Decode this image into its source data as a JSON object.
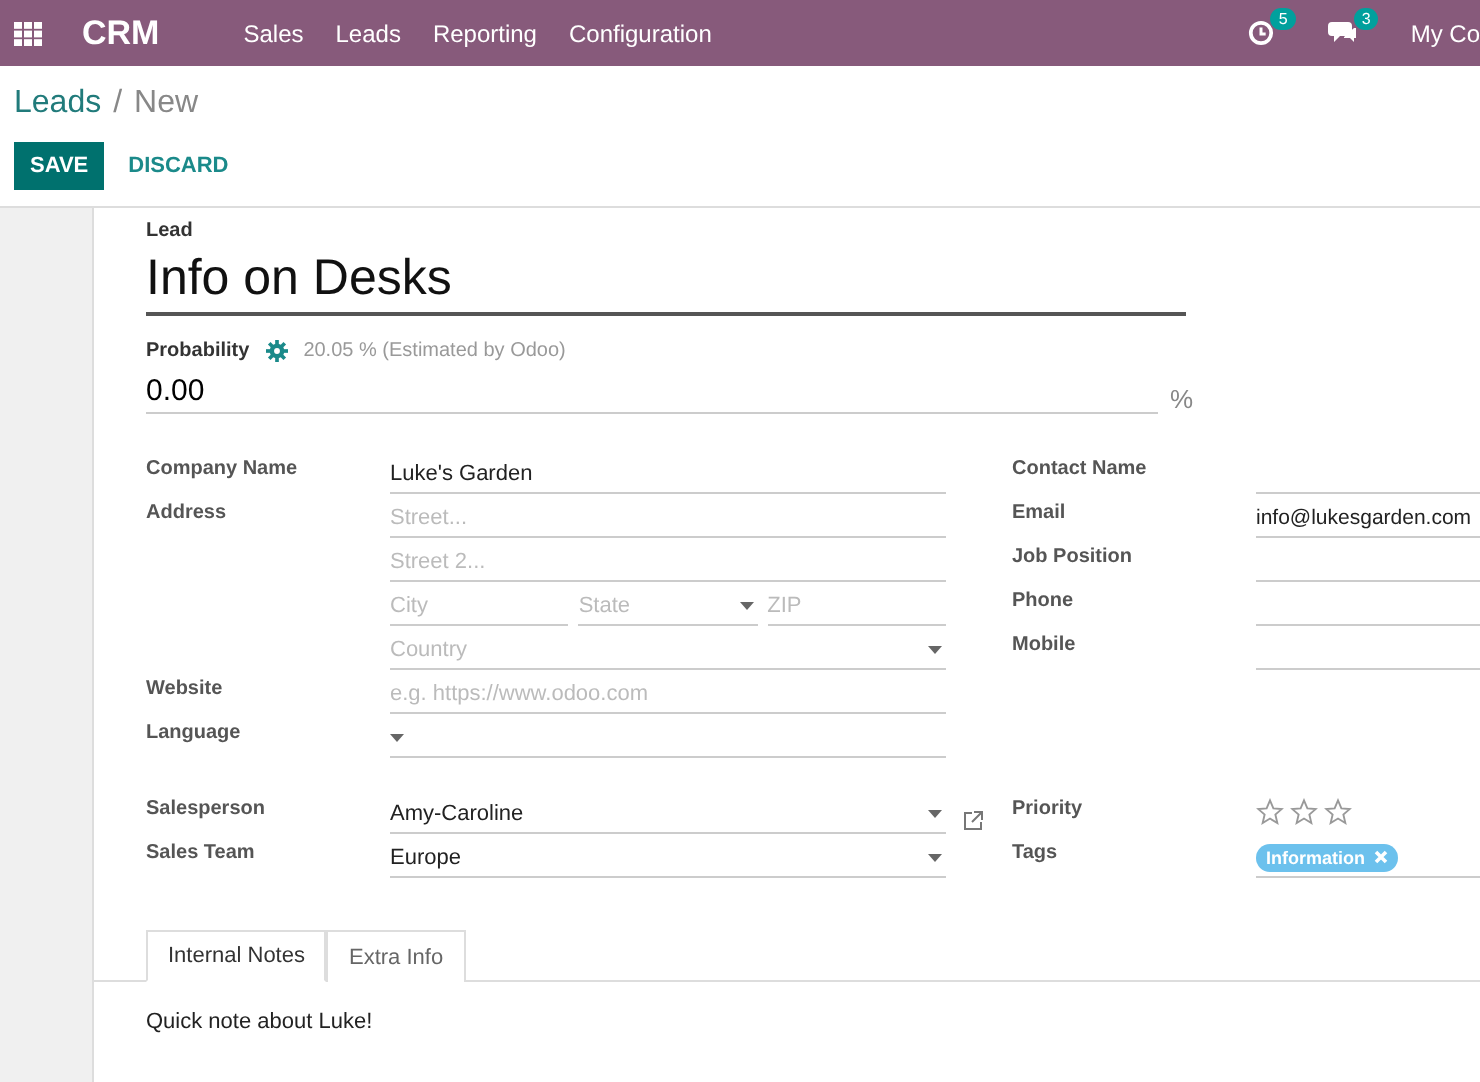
{
  "navbar": {
    "app_name": "CRM",
    "menu": [
      "Sales",
      "Leads",
      "Reporting",
      "Configuration"
    ],
    "activity_count": "5",
    "message_count": "3",
    "company": "My Co"
  },
  "breadcrumb": {
    "parent": "Leads",
    "separator": "/",
    "current": "New"
  },
  "buttons": {
    "primary": "SAVE",
    "secondary": "DISCARD"
  },
  "lead": {
    "label": "Lead",
    "title": "Info on Desks",
    "probability_label": "Probability",
    "probability_estimate": "20.05 % (Estimated by Odoo)",
    "probability": "0.00",
    "percent_sign": "%"
  },
  "left_fields": [
    {
      "label": "Company Name",
      "rows": [
        [
          {
            "kind": "text",
            "value": "Luke's Garden"
          }
        ]
      ],
      "link": false
    },
    {
      "label": "Address",
      "rows": [
        [
          {
            "kind": "text",
            "placeholder": "Street..."
          }
        ],
        [
          {
            "kind": "text",
            "placeholder": "Street 2..."
          }
        ],
        [
          {
            "kind": "text",
            "placeholder": "City"
          },
          {
            "kind": "select",
            "placeholder": "State"
          },
          {
            "kind": "text",
            "placeholder": "ZIP"
          }
        ],
        [
          {
            "kind": "select",
            "placeholder": "Country"
          }
        ]
      ],
      "link": false
    },
    {
      "label": "Website",
      "rows": [
        [
          {
            "kind": "text",
            "placeholder": "e.g. https://www.odoo.com"
          }
        ]
      ],
      "link": false
    },
    {
      "label": "Language",
      "rows": [
        [
          {
            "kind": "select"
          }
        ]
      ],
      "link": false
    },
    {
      "label": "Salesperson",
      "rows": [
        [
          {
            "kind": "select",
            "value": "Amy-Caroline"
          }
        ]
      ],
      "link": true
    },
    {
      "label": "Sales Team",
      "rows": [
        [
          {
            "kind": "select",
            "value": "Europe"
          }
        ]
      ],
      "link": false
    }
  ],
  "right_fields": [
    {
      "label": "Contact Name",
      "kind": "text"
    },
    {
      "label": "Email",
      "kind": "text",
      "value": "info@lukesgarden.com"
    },
    {
      "label": "Job Position",
      "kind": "text"
    },
    {
      "label": "Phone",
      "kind": "text"
    },
    {
      "label": "Mobile",
      "kind": "text"
    },
    {
      "label": "Priority",
      "kind": "stars",
      "stars": 0
    },
    {
      "label": "Tags",
      "kind": "tags",
      "tags": [
        {
          "label": "Information",
          "color": "#6cc1ed"
        }
      ]
    }
  ],
  "tabs": [
    {
      "label": "Internal Notes",
      "selected": true
    },
    {
      "label": "Extra Info",
      "selected": false
    }
  ],
  "notes": "Quick note about Luke!"
}
